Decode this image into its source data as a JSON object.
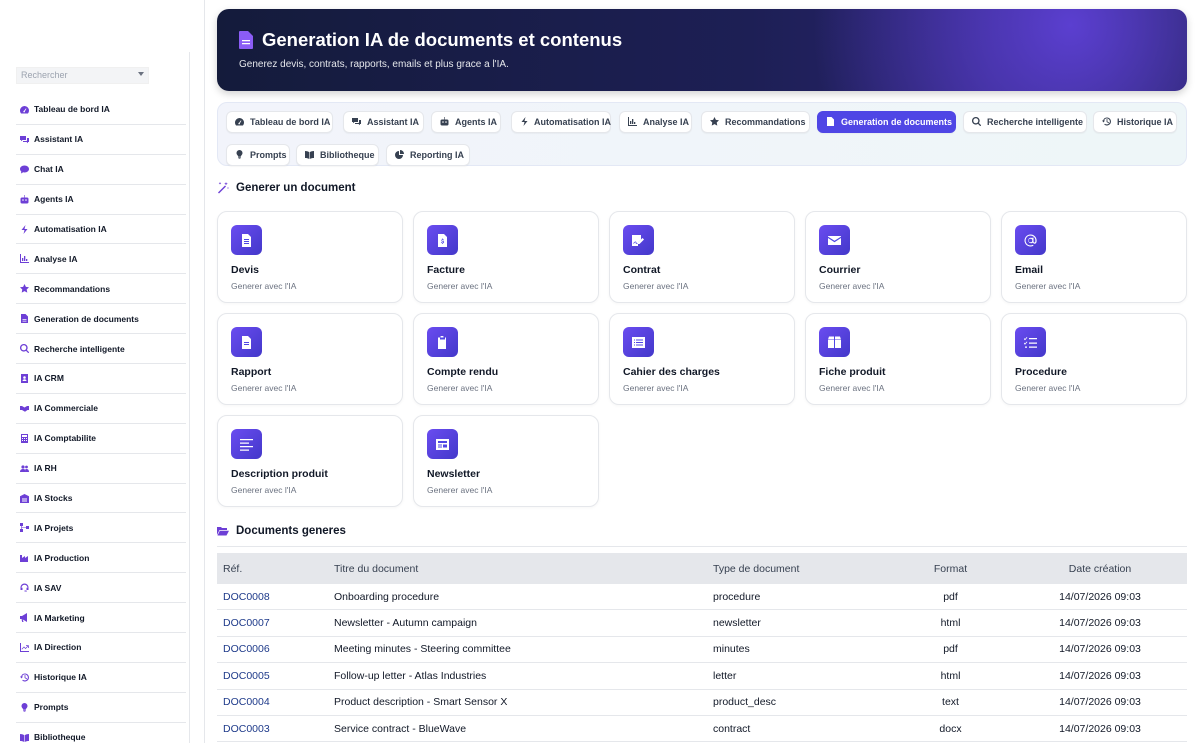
{
  "sidebar": {
    "search_placeholder": "Rechercher",
    "items": [
      {
        "label": "Tableau de bord IA",
        "icon": "dashboard-icon"
      },
      {
        "label": "Assistant IA",
        "icon": "chat-bubbles-icon"
      },
      {
        "label": "Chat IA",
        "icon": "chat-icon"
      },
      {
        "label": "Agents IA",
        "icon": "robot-icon"
      },
      {
        "label": "Automatisation IA",
        "icon": "bolt-icon"
      },
      {
        "label": "Analyse IA",
        "icon": "chart-icon"
      },
      {
        "label": "Recommandations",
        "icon": "star-icon"
      },
      {
        "label": "Generation de documents",
        "icon": "file-icon"
      },
      {
        "label": "Recherche intelligente",
        "icon": "search-icon"
      },
      {
        "label": "IA CRM",
        "icon": "contact-card-icon"
      },
      {
        "label": "IA Commerciale",
        "icon": "handshake-icon"
      },
      {
        "label": "IA Comptabilite",
        "icon": "calculator-icon"
      },
      {
        "label": "IA RH",
        "icon": "users-icon"
      },
      {
        "label": "IA Stocks",
        "icon": "warehouse-icon"
      },
      {
        "label": "IA Projets",
        "icon": "project-tree-icon"
      },
      {
        "label": "IA Production",
        "icon": "industry-icon"
      },
      {
        "label": "IA SAV",
        "icon": "headset-icon"
      },
      {
        "label": "IA Marketing",
        "icon": "megaphone-icon"
      },
      {
        "label": "IA Direction",
        "icon": "trend-icon"
      },
      {
        "label": "Historique IA",
        "icon": "history-icon"
      },
      {
        "label": "Prompts",
        "icon": "lightbulb-icon"
      },
      {
        "label": "Bibliotheque",
        "icon": "book-icon"
      }
    ]
  },
  "hero": {
    "title": "Generation IA de documents et contenus",
    "subtitle": "Generez devis, contrats, rapports, emails et plus grace a l'IA."
  },
  "tabs": [
    {
      "label": "Tableau de bord IA",
      "icon": "dashboard-icon"
    },
    {
      "label": "Assistant IA",
      "icon": "chat-bubbles-icon"
    },
    {
      "label": "Agents IA",
      "icon": "robot-icon"
    },
    {
      "label": "Automatisation IA",
      "icon": "bolt-icon"
    },
    {
      "label": "Analyse IA",
      "icon": "chart-icon"
    },
    {
      "label": "Recommandations",
      "icon": "star-icon"
    },
    {
      "label": "Generation de documents",
      "icon": "file-icon",
      "active": true
    },
    {
      "label": "Recherche intelligente",
      "icon": "search-icon"
    },
    {
      "label": "Historique IA",
      "icon": "history-icon"
    },
    {
      "label": "Prompts",
      "icon": "lightbulb-icon"
    },
    {
      "label": "Bibliotheque",
      "icon": "book-icon"
    },
    {
      "label": "Reporting IA",
      "icon": "pie-chart-icon"
    }
  ],
  "generate": {
    "title": "Generer un document",
    "cards": [
      {
        "title": "Devis",
        "subtitle": "Generer avec l'IA",
        "icon": "invoice-icon"
      },
      {
        "title": "Facture",
        "subtitle": "Generer avec l'IA",
        "icon": "dollar-file-icon"
      },
      {
        "title": "Contrat",
        "subtitle": "Generer avec l'IA",
        "icon": "signature-icon"
      },
      {
        "title": "Courrier",
        "subtitle": "Generer avec l'IA",
        "icon": "envelope-icon"
      },
      {
        "title": "Email",
        "subtitle": "Generer avec l'IA",
        "icon": "at-icon"
      },
      {
        "title": "Rapport",
        "subtitle": "Generer avec l'IA",
        "icon": "report-icon"
      },
      {
        "title": "Compte rendu",
        "subtitle": "Generer avec l'IA",
        "icon": "clipboard-icon"
      },
      {
        "title": "Cahier des charges",
        "subtitle": "Generer avec l'IA",
        "icon": "list-box-icon"
      },
      {
        "title": "Fiche produit",
        "subtitle": "Generer avec l'IA",
        "icon": "box-icon"
      },
      {
        "title": "Procedure",
        "subtitle": "Generer avec l'IA",
        "icon": "checklist-icon"
      },
      {
        "title": "Description produit",
        "subtitle": "Generer avec l'IA",
        "icon": "text-lines-icon"
      },
      {
        "title": "Newsletter",
        "subtitle": "Generer avec l'IA",
        "icon": "newspaper-icon"
      }
    ]
  },
  "documents": {
    "title": "Documents generes",
    "columns": [
      "Réf.",
      "Titre du document",
      "Type de document",
      "Format",
      "Date création"
    ],
    "rows": [
      [
        "DOC0008",
        "Onboarding procedure",
        "procedure",
        "pdf",
        "14/07/2026 09:03"
      ],
      [
        "DOC0007",
        "Newsletter - Autumn campaign",
        "newsletter",
        "html",
        "14/07/2026 09:03"
      ],
      [
        "DOC0006",
        "Meeting minutes - Steering committee",
        "minutes",
        "pdf",
        "14/07/2026 09:03"
      ],
      [
        "DOC0005",
        "Follow-up letter - Atlas Industries",
        "letter",
        "html",
        "14/07/2026 09:03"
      ],
      [
        "DOC0004",
        "Product description - Smart Sensor X",
        "product_desc",
        "text",
        "14/07/2026 09:03"
      ],
      [
        "DOC0003",
        "Service contract - BlueWave",
        "contract",
        "docx",
        "14/07/2026 09:03"
      ]
    ]
  },
  "colors": {
    "accent": "#4f46e5",
    "icon_purple": "#6d3fd6",
    "hero_dark": "#141b3b",
    "ref_link": "#1e3a8a"
  }
}
